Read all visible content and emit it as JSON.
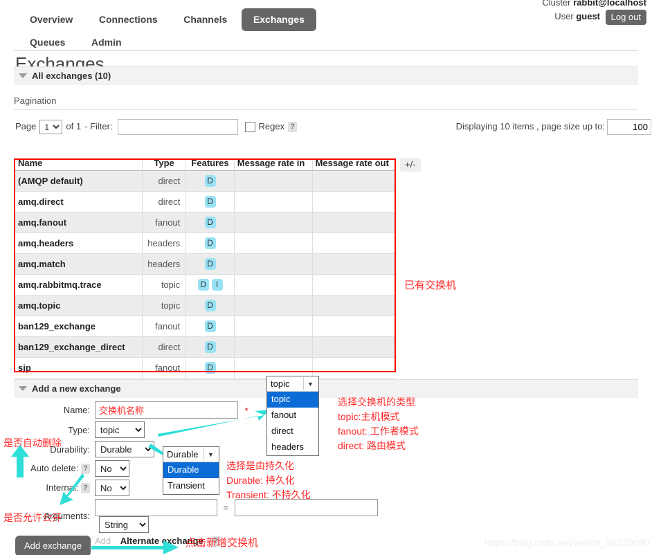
{
  "header": {
    "cluster_label": "Cluster",
    "cluster_name": "rabbit@localhost",
    "user_label": "User",
    "user_name": "guest",
    "logout_label": "Log out"
  },
  "nav": {
    "row1": [
      {
        "label": "Overview",
        "active": false
      },
      {
        "label": "Connections",
        "active": false
      },
      {
        "label": "Channels",
        "active": false
      },
      {
        "label": "Exchanges",
        "active": true
      }
    ],
    "row2": [
      {
        "label": "Queues",
        "active": false
      },
      {
        "label": "Admin",
        "active": false
      }
    ]
  },
  "page": {
    "title": "Exchanges"
  },
  "all_exchanges": {
    "section_label": "All exchanges (10)",
    "pagination_label": "Pagination",
    "page_label": "Page",
    "page_value": "1",
    "of_label": "of 1",
    "filter_label": "- Filter:",
    "filter_value": "",
    "regex_label": "Regex",
    "help_glyph": "?",
    "displaying_text": "Displaying 10 items , page size up to:",
    "page_size_value": "100",
    "plus_minus_label": "+/-"
  },
  "table": {
    "columns": [
      "Name",
      "Type",
      "Features",
      "Message rate in",
      "Message rate out"
    ],
    "rows": [
      {
        "name": "(AMQP default)",
        "type": "direct",
        "features": [
          "D"
        ],
        "rate_in": "",
        "rate_out": ""
      },
      {
        "name": "amq.direct",
        "type": "direct",
        "features": [
          "D"
        ],
        "rate_in": "",
        "rate_out": ""
      },
      {
        "name": "amq.fanout",
        "type": "fanout",
        "features": [
          "D"
        ],
        "rate_in": "",
        "rate_out": ""
      },
      {
        "name": "amq.headers",
        "type": "headers",
        "features": [
          "D"
        ],
        "rate_in": "",
        "rate_out": ""
      },
      {
        "name": "amq.match",
        "type": "headers",
        "features": [
          "D"
        ],
        "rate_in": "",
        "rate_out": ""
      },
      {
        "name": "amq.rabbitmq.trace",
        "type": "topic",
        "features": [
          "D",
          "I"
        ],
        "rate_in": "",
        "rate_out": ""
      },
      {
        "name": "amq.topic",
        "type": "topic",
        "features": [
          "D"
        ],
        "rate_in": "",
        "rate_out": ""
      },
      {
        "name": "ban129_exchange",
        "type": "fanout",
        "features": [
          "D"
        ],
        "rate_in": "",
        "rate_out": ""
      },
      {
        "name": "ban129_exchange_direct",
        "type": "direct",
        "features": [
          "D"
        ],
        "rate_in": "",
        "rate_out": ""
      },
      {
        "name": "sjp",
        "type": "fanout",
        "features": [
          "D"
        ],
        "rate_in": "",
        "rate_out": ""
      }
    ]
  },
  "add_form": {
    "section_label": "Add a new exchange",
    "name_label": "Name:",
    "name_value": "交换机名称",
    "name_required": "*",
    "type_label": "Type:",
    "type_value": "topic",
    "durability_label": "Durability:",
    "durability_value": "Durable",
    "auto_delete_label": "Auto delete:",
    "auto_delete_value": "No",
    "internal_label": "Internal:",
    "internal_value": "No",
    "arguments_label": "Arguments:",
    "arg_key_value": "",
    "arg_eq": "=",
    "arg_val_value": "",
    "arg_type_value": "String",
    "add_link": "Add",
    "alternate_exchange": "Alternate exchange",
    "submit_label": "Add exchange"
  },
  "dropdowns": {
    "type_open": {
      "selected": "topic",
      "options": [
        "topic",
        "fanout",
        "direct",
        "headers"
      ]
    },
    "durability_open": {
      "selected": "Durable",
      "options": [
        "Durable",
        "Transient"
      ]
    }
  },
  "annotations": {
    "existing_exchanges": "已有交换机",
    "type_note": "选择交换机的类型\ntopic:主机模式\nfanout: 工作者模式\ndirect: 路由模式",
    "durability_note": "选择是由持久化\nDurable: 持久化\nTransient: 不持久化",
    "auto_delete_note": "是否自动删除",
    "internal_note": "是否允许公开",
    "submit_note": "点击新增交换机"
  },
  "watermark": "https://blog.csdn.net/weixin_56320090",
  "colors": {
    "accent_red": "#fe2a2a",
    "arrow_cyan": "#2fded8",
    "badge_blue": "#99e2f5",
    "active_tab": "#666666"
  }
}
